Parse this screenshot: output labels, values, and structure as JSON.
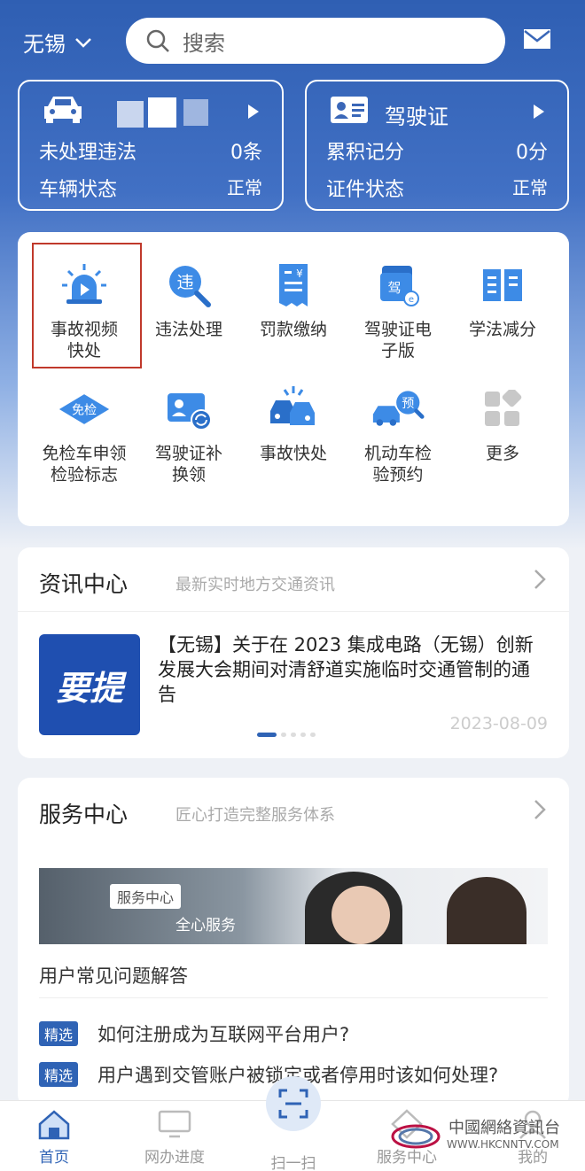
{
  "header": {
    "city": "无锡",
    "search_placeholder": "搜索"
  },
  "vehicle_card": {
    "plate": "",
    "violations_label": "未处理违法",
    "violations_value": "0条",
    "status_label": "车辆状态",
    "status_value": "正常"
  },
  "license_card": {
    "title": "驾驶证",
    "points_label": "累积记分",
    "points_value": "0分",
    "status_label": "证件状态",
    "status_value": "正常"
  },
  "services": [
    {
      "label": "事故视频快处",
      "icon": "alarm-video-icon"
    },
    {
      "label": "违法处理",
      "icon": "violation-search-icon"
    },
    {
      "label": "罚款缴纳",
      "icon": "fine-receipt-icon"
    },
    {
      "label": "驾驶证电子版",
      "icon": "e-license-icon"
    },
    {
      "label": "学法减分",
      "icon": "book-icon"
    },
    {
      "label": "免检车申领检验标志",
      "icon": "exempt-badge-icon"
    },
    {
      "label": "驾驶证补换领",
      "icon": "license-renew-icon"
    },
    {
      "label": "事故快处",
      "icon": "accident-icon"
    },
    {
      "label": "机动车检验预约",
      "icon": "inspection-booking-icon"
    },
    {
      "label": "更多",
      "icon": "more-grid-icon"
    }
  ],
  "news": {
    "title": "资讯中心",
    "subtitle": "最新实时地方交通资讯",
    "thumb_text": "要提",
    "headline": "【无锡】关于在 2023 集成电路（无锡）创新发展大会期间对清舒道实施临时交通管制的通告",
    "date": "2023-08-09"
  },
  "service_center": {
    "title": "服务中心",
    "subtitle": "匠心打造完整服务体系",
    "banner_tag": "服务中心",
    "banner_text": "全心服务",
    "faq_title": "用户常见问题解答",
    "faq": [
      {
        "tag": "精选",
        "text": "如何注册成为互联网平台用户?"
      },
      {
        "tag": "精选",
        "text": "用户遇到交管账户被锁定或者停用时该如何处理?"
      }
    ]
  },
  "tabs": [
    "首页",
    "网办进度",
    "扫一扫",
    "服务中心",
    "我的"
  ],
  "watermark": {
    "line1": "中國網絡資訊台",
    "line2": "WWW.HKCNNTV.COM"
  },
  "colors": {
    "accent": "#2f63b5",
    "highlight_border": "#c0392b"
  }
}
